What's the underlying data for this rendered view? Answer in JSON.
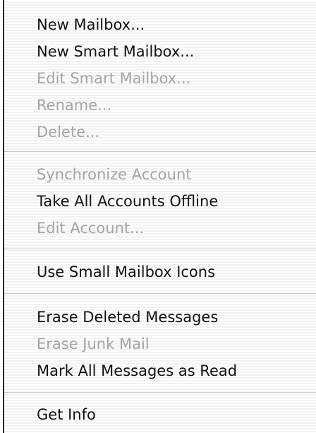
{
  "menu": {
    "items": [
      {
        "label": "New Mailbox...",
        "enabled": true
      },
      {
        "label": "New Smart Mailbox...",
        "enabled": true
      },
      {
        "label": "Edit Smart Mailbox...",
        "enabled": false
      },
      {
        "label": "Rename...",
        "enabled": false
      },
      {
        "label": "Delete...",
        "enabled": false
      },
      {
        "label": "Synchronize Account",
        "enabled": false
      },
      {
        "label": "Take All Accounts Offline",
        "enabled": true
      },
      {
        "label": "Edit Account...",
        "enabled": false
      },
      {
        "label": "Use Small Mailbox Icons",
        "enabled": true
      },
      {
        "label": "Erase Deleted Messages",
        "enabled": true
      },
      {
        "label": "Erase Junk Mail",
        "enabled": false
      },
      {
        "label": "Mark All Messages as Read",
        "enabled": true
      },
      {
        "label": "Get Info",
        "enabled": true
      }
    ]
  }
}
